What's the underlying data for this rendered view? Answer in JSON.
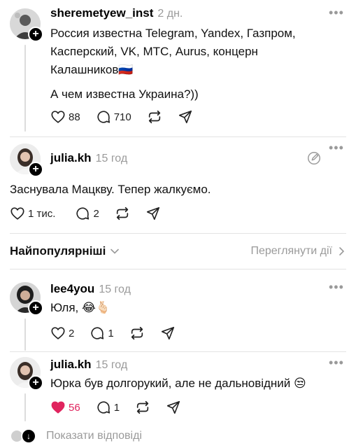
{
  "posts": [
    {
      "username": "sheremetyew_inst",
      "time": "2 дн.",
      "text_lines": [
        "Россия известна Telegram, Yandex, Газпром,",
        "Касперский, VK, МТС, Aurus, концерн",
        "Калашников🇷🇺"
      ],
      "text2": "А чем известна Украина?))",
      "likes": "88",
      "comments": "710"
    },
    {
      "username": "julia.kh",
      "time": "15 год",
      "text": "Заснувала Мацкву. Тепер жалкуємо.",
      "likes": "1 тис.",
      "comments": "2"
    }
  ],
  "sort": {
    "label": "Найпопулярніші",
    "view_activity": "Переглянути дії"
  },
  "comments": [
    {
      "username": "lee4you",
      "time": "15 год",
      "text": "Юля, 😂🫰🏻",
      "likes": "2",
      "comments": "1"
    },
    {
      "username": "julia.kh",
      "time": "15 год",
      "text": "Юрка був долгорукий, але не дальновідний 😒",
      "likes": "56",
      "comments": "1",
      "liked": true
    }
  ],
  "show_replies": "Показати відповіді",
  "colors": {
    "like_active": "#e0245e",
    "muted": "#9a9a9a",
    "divider": "#e3e3e3"
  },
  "icons": [
    "heart-icon",
    "comment-icon",
    "repost-icon",
    "share-icon",
    "more-icon",
    "chevron-down-icon",
    "chevron-right-icon",
    "plus-icon",
    "edit-icon",
    "arrow-down-icon"
  ]
}
